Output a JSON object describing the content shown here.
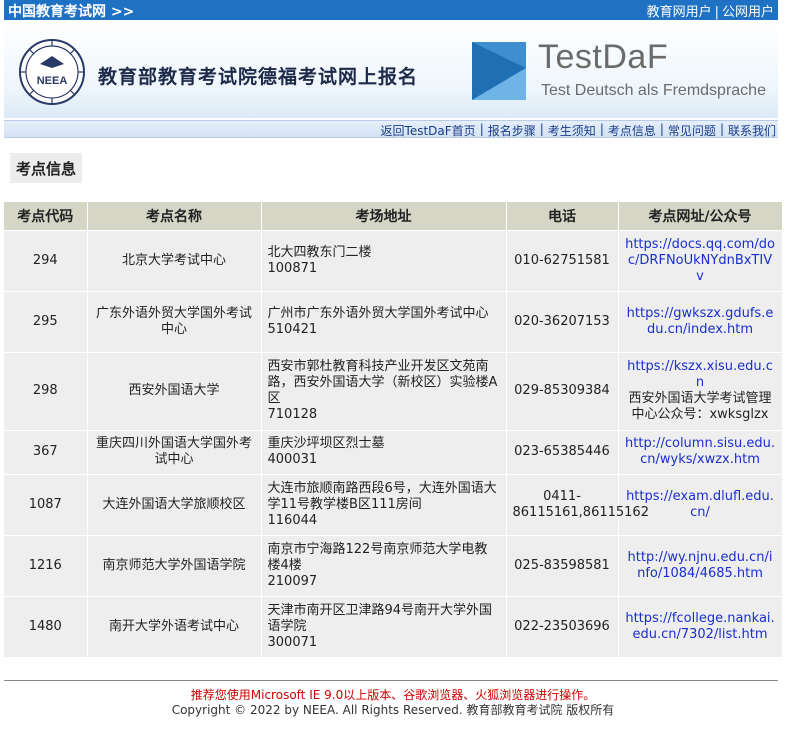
{
  "topbar": {
    "site_link": "中国教育考试网 >>",
    "user_links": [
      "教育网用户",
      "公网用户"
    ],
    "separator": "|"
  },
  "banner": {
    "neea_logo_text": "NEEA",
    "title": "教育部教育考试院德福考试网上报名",
    "testdaf_name": "TestDaF",
    "testdaf_subtitle": "Test Deutsch als Fremdsprache"
  },
  "nav": {
    "items": [
      "返回TestDaF首页",
      "报名步骤",
      "考生须知",
      "考点信息",
      "常见问题",
      "联系我们"
    ],
    "separator": "|"
  },
  "section": {
    "title": "考点信息"
  },
  "table": {
    "headers": [
      "考点代码",
      "考点名称",
      "考场地址",
      "电话",
      "考点网址/公众号"
    ],
    "rows": [
      {
        "code": "294",
        "name": "北京大学考试中心",
        "address": "北大四教东门二楼",
        "zip": "100871",
        "phone": "010-62751581",
        "url": "https://docs.qq.com/doc/DRFNoUkNYdnBxTIVv",
        "extra": ""
      },
      {
        "code": "295",
        "name": "广东外语外贸大学国外考试中心",
        "address": "广州市广东外语外贸大学国外考试中心",
        "zip": "510421",
        "phone": "020-36207153",
        "url": "https://gwkszx.gdufs.edu.cn/index.htm",
        "extra": ""
      },
      {
        "code": "298",
        "name": "西安外国语大学",
        "address": "西安市郭杜教育科技产业开发区文苑南路，西安外国语大学（新校区）实验楼A区",
        "zip": "710128",
        "phone": "029-85309384",
        "url": "https://kszx.xisu.edu.cn",
        "extra": "西安外国语大学考试管理中心公众号：xwksglzx"
      },
      {
        "code": "367",
        "name": "重庆四川外国语大学国外考试中心",
        "address": "重庆沙坪坝区烈士墓",
        "zip": "400031",
        "phone": "023-65385446",
        "url": "http://column.sisu.edu.cn/wyks/xwzx.htm",
        "extra": ""
      },
      {
        "code": "1087",
        "name": "大连外国语大学旅顺校区",
        "address": "大连市旅顺南路西段6号，大连外国语大学11号教学楼B区111房间",
        "zip": "116044",
        "phone": "0411-86115161,86115162",
        "url": "https://exam.dlufl.edu.cn/",
        "extra": ""
      },
      {
        "code": "1216",
        "name": "南京师范大学外国语学院",
        "address": "南京市宁海路122号南京师范大学电教楼4楼",
        "zip": "210097",
        "phone": "025-83598581",
        "url": "http://wy.njnu.edu.cn/info/1084/4685.htm",
        "extra": ""
      },
      {
        "code": "1480",
        "name": "南开大学外语考试中心",
        "address": "天津市南开区卫津路94号南开大学外国语学院",
        "zip": "300071",
        "phone": "022-23503696",
        "url": "https://fcollege.nankai.edu.cn/7302/list.htm",
        "extra": ""
      }
    ]
  },
  "footer": {
    "note": "推荐您使用Microsoft IE 9.0以上版本、谷歌浏览器、火狐浏览器进行操作。",
    "copyright": "Copyright © 2022 by NEEA. All Rights Reserved. 教育部教育考试院 版权所有"
  },
  "colors": {
    "topbar": "#1f72c3",
    "table_header": "#d6d6c6",
    "table_cell": "#eeeeee",
    "link": "#1a2ed0",
    "footer_note": "#cc0000"
  }
}
